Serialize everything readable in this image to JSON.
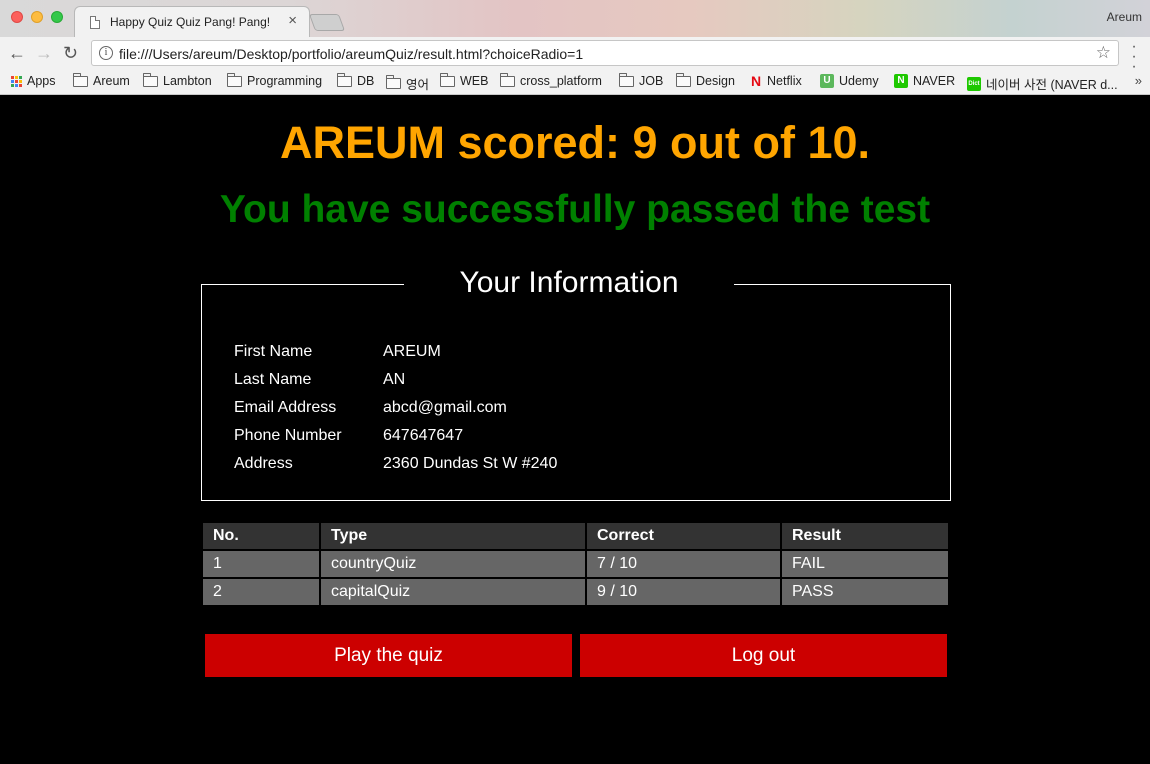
{
  "browser": {
    "tab_title": "Happy Quiz Quiz Pang! Pang!",
    "profile_name": "Areum",
    "url": "file:///Users/areum/Desktop/portfolio/areumQuiz/result.html?choiceRadio=1",
    "bookmarks": [
      {
        "label": "Apps",
        "icon": "apps-grid-icon"
      },
      {
        "label": "Areum",
        "icon": "folder-icon"
      },
      {
        "label": "Lambton",
        "icon": "folder-icon"
      },
      {
        "label": "Programming",
        "icon": "folder-icon"
      },
      {
        "label": "DB",
        "icon": "folder-icon"
      },
      {
        "label": "영어",
        "icon": "folder-icon"
      },
      {
        "label": "WEB",
        "icon": "folder-icon"
      },
      {
        "label": "cross_platform",
        "icon": "folder-icon"
      },
      {
        "label": "JOB",
        "icon": "folder-icon"
      },
      {
        "label": "Design",
        "icon": "folder-icon"
      },
      {
        "label": "Netflix",
        "icon": "netflix-icon"
      },
      {
        "label": "Udemy",
        "icon": "udemy-icon"
      },
      {
        "label": "NAVER",
        "icon": "naver-icon"
      },
      {
        "label": "네이버 사전 (NAVER d...",
        "icon": "naver-dict-icon"
      }
    ]
  },
  "result": {
    "score_text": "AREUM scored: 9 out of 10.",
    "status_text": "You have successfully passed the test"
  },
  "info": {
    "legend": "Your Information",
    "fields": [
      {
        "label": "First Name",
        "value": "AREUM"
      },
      {
        "label": "Last Name",
        "value": "AN"
      },
      {
        "label": "Email Address",
        "value": "abcd@gmail.com"
      },
      {
        "label": "Phone Number",
        "value": "647647647"
      },
      {
        "label": "Address",
        "value": "2360 Dundas St W #240"
      }
    ]
  },
  "table": {
    "headers": [
      "No.",
      "Type",
      "Correct",
      "Result"
    ],
    "rows": [
      [
        "1",
        "countryQuiz",
        "7 / 10",
        "FAIL"
      ],
      [
        "2",
        "capitalQuiz",
        "9 / 10",
        "PASS"
      ]
    ]
  },
  "buttons": {
    "play": "Play the quiz",
    "logout": "Log out"
  },
  "colors": {
    "score": "#ffa500",
    "passed": "#008000",
    "button": "#cc0000",
    "table_header": "#333333",
    "table_cell": "#666666"
  }
}
